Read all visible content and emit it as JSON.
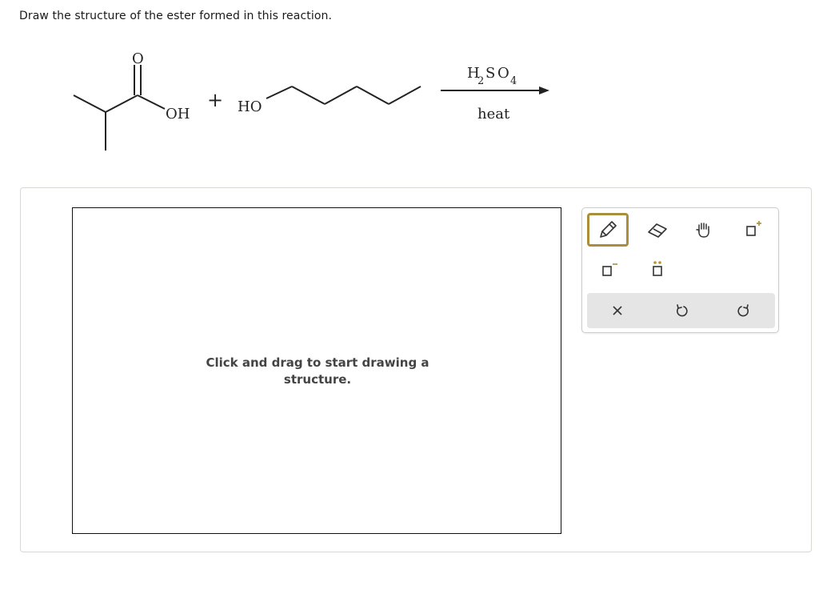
{
  "question": {
    "prompt": "Draw the structure of the ester formed in this reaction."
  },
  "reaction": {
    "acid": {
      "carbonyl_o": "O",
      "hydroxyl": "OH"
    },
    "plus": "+",
    "alcohol": {
      "hydroxyl": "HO"
    },
    "reagent": {
      "h": "H",
      "h_sub": "2",
      "s": "S",
      "o": "O",
      "o_sub": "4"
    },
    "condition": "heat"
  },
  "editor": {
    "canvas_hint": "Click and drag to start drawing a structure.",
    "tools": [
      {
        "icon": "pencil-icon",
        "active": true
      },
      {
        "icon": "eraser-icon",
        "active": false
      },
      {
        "icon": "hand-icon",
        "active": false
      },
      {
        "icon": "positive-charge-icon",
        "active": false
      },
      {
        "icon": "negative-charge-icon",
        "active": false
      },
      {
        "icon": "lone-pair-icon",
        "active": false
      }
    ],
    "actions": [
      {
        "icon": "clear-icon"
      },
      {
        "icon": "undo-icon"
      },
      {
        "icon": "redo-icon"
      }
    ],
    "colors": {
      "accent": "#a98f3c",
      "action_bar": "#e5e5e5",
      "lone_pair": "#b8952a"
    }
  }
}
